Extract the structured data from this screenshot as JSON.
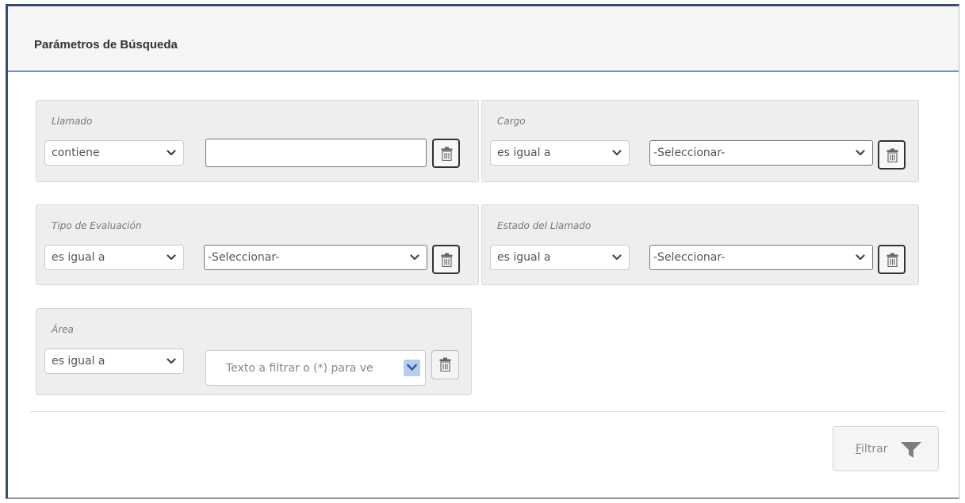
{
  "panel": {
    "title": "Parámetros de Búsqueda"
  },
  "filters": {
    "llamado": {
      "label": "Llamado",
      "operator": "contiene",
      "value": ""
    },
    "cargo": {
      "label": "Cargo",
      "operator": "es igual a",
      "value": "-Seleccionar-"
    },
    "tipo_evaluacion": {
      "label": "Tipo de Evaluación",
      "operator": "es igual a",
      "value": "-Seleccionar-"
    },
    "estado_llamado": {
      "label": "Estado del Llamado",
      "operator": "es igual a",
      "value": "-Seleccionar-"
    },
    "area": {
      "label": "Área",
      "operator": "es igual a",
      "placeholder": "Texto a filtrar o (*) para ve"
    }
  },
  "actions": {
    "filter_label": "Filtrar"
  },
  "icons": {
    "trash": "trash-icon",
    "chevron": "chevron-down-icon",
    "funnel": "funnel-icon"
  },
  "colors": {
    "header_accent": "#6d93c2",
    "frame": "#3a4a6b",
    "group_bg": "#eeeeee",
    "combo_button": "#b7cdea"
  }
}
